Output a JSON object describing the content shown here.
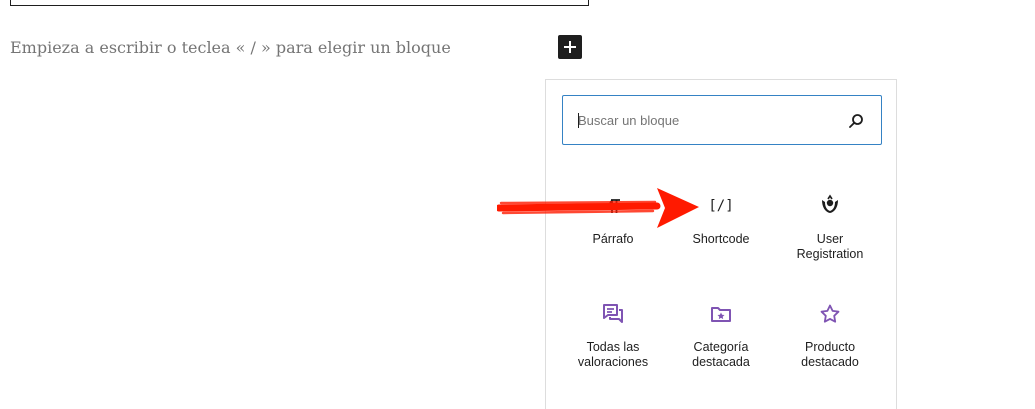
{
  "editor": {
    "placeholder": "Empieza a escribir o teclea « / » para elegir un bloque"
  },
  "inserter": {
    "search_placeholder": "Buscar un bloque",
    "blocks": [
      {
        "label": "Párrafo",
        "icon": "paragraph-icon"
      },
      {
        "label": "Shortcode",
        "icon": "shortcode-icon",
        "icon_text": "[/]"
      },
      {
        "label": "User\nRegistration",
        "icon": "user-registration-icon"
      },
      {
        "label": "Todas las\nvaloraciones",
        "icon": "reviews-icon"
      },
      {
        "label": "Categoría\ndestacada",
        "icon": "featured-category-icon"
      },
      {
        "label": "Producto\ndestacado",
        "icon": "star-icon"
      }
    ]
  },
  "colors": {
    "accent": "#3582c4",
    "woo_purple": "#7f54b3",
    "annotation_red": "#ff1a00"
  }
}
